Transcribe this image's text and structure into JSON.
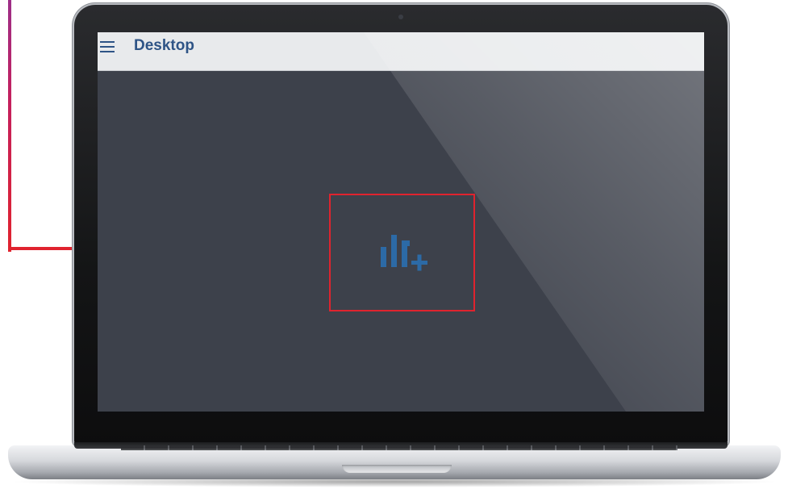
{
  "app": {
    "title": "Desktop"
  },
  "icons": {
    "menu": "hamburger-menu-icon",
    "add_widget": "add-chart-widget-icon"
  },
  "colors": {
    "header_bg": "#e8eaec",
    "title_text": "#2e5486",
    "screen_bg": "#3d414b",
    "widget_icon": "#2c6aa6",
    "annotation": "#e0232e"
  }
}
